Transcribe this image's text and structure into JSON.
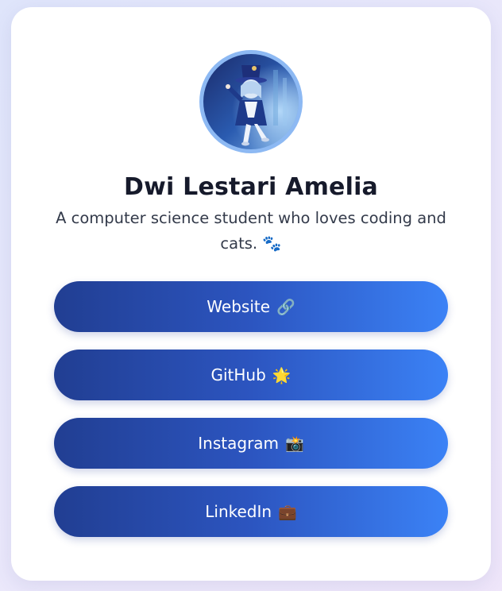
{
  "profile": {
    "name": "Dwi Lestari Amelia",
    "bio_line1": "A computer science student who loves coding and",
    "bio_line2": "cats.",
    "bio_emoji": "🐾"
  },
  "links": [
    {
      "label": "Website",
      "emoji": "🔗",
      "icon": "link-icon"
    },
    {
      "label": "GitHub",
      "emoji": "🌟",
      "icon": "glowing-star-icon"
    },
    {
      "label": "Instagram",
      "emoji": "📸",
      "icon": "camera-icon"
    },
    {
      "label": "LinkedIn",
      "emoji": "💼",
      "icon": "briefcase-icon"
    }
  ],
  "colors": {
    "accent_start": "#213e92",
    "accent_end": "#3b82f6",
    "avatar_ring": "#8db9f3"
  }
}
